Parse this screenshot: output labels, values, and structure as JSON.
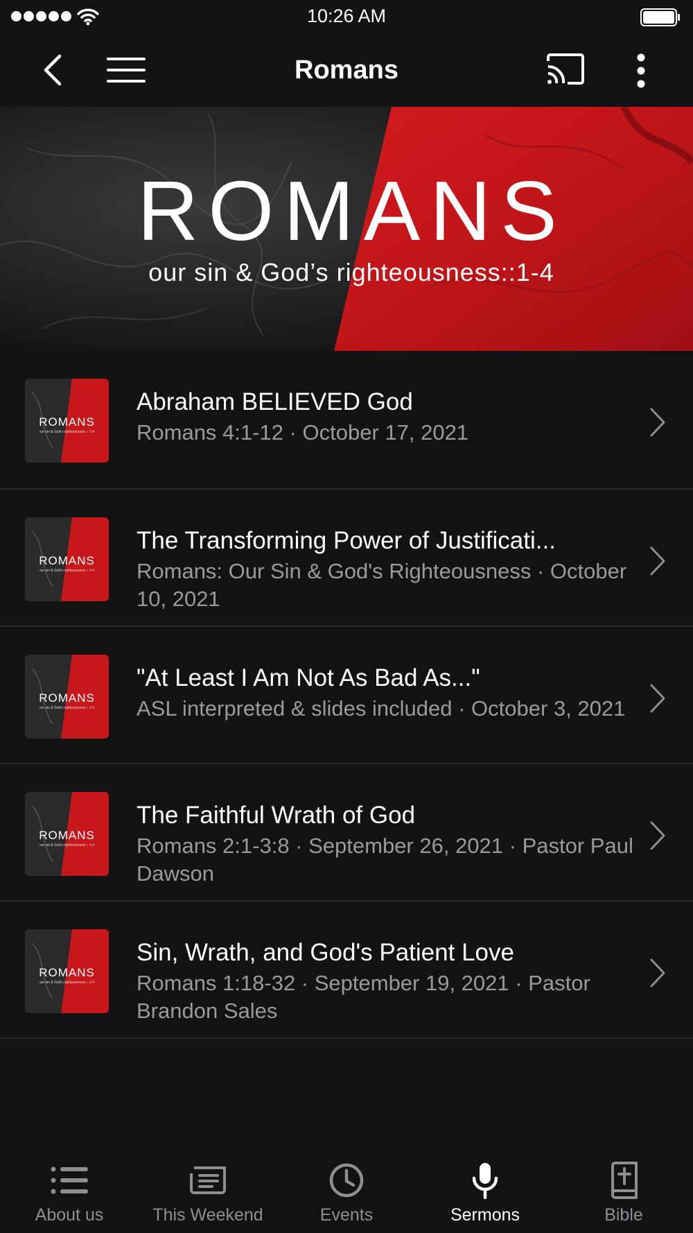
{
  "status_bar": {
    "time": "10:26 AM"
  },
  "nav": {
    "title": "Romans",
    "back_icon": "chevron-left-icon",
    "menu_icon": "hamburger-menu-icon",
    "cast_icon": "cast-icon",
    "more_icon": "more-vertical-icon"
  },
  "banner": {
    "title": "ROMANS",
    "subtitle": "our sin & God’s righteousness::1-4",
    "colors": {
      "dark": "#1e1e1e",
      "red": "#c8171b"
    }
  },
  "sermons": [
    {
      "title": "Abraham BELIEVED God",
      "subtitle": "Romans 4:1-12 · October 17, 2021",
      "thumbnail_title": "ROMANS",
      "thumbnail_subtitle": "our sin & God's righteousness :: 1-4"
    },
    {
      "title": "The Transforming Power of Justificati...",
      "subtitle": "Romans: Our Sin & God's Righteousness · October 10, 2021",
      "thumbnail_title": "ROMANS",
      "thumbnail_subtitle": "our sin & God's righteousness :: 1-4"
    },
    {
      "title": "\"At Least I Am Not As Bad As...\"",
      "subtitle": "ASL interpreted & slides included · October 3, 2021",
      "thumbnail_title": "ROMANS",
      "thumbnail_subtitle": "our sin & God's righteousness :: 1-4"
    },
    {
      "title": "The Faithful Wrath of God",
      "subtitle": "Romans 2:1-3:8 · September 26, 2021 · Pastor Paul Dawson",
      "thumbnail_title": "ROMANS",
      "thumbnail_subtitle": "our sin & God's righteousness :: 1-4"
    },
    {
      "title": "Sin, Wrath, and God's Patient Love",
      "subtitle": "Romans 1:18-32 · September 19, 2021 · Pastor Brandon Sales",
      "thumbnail_title": "ROMANS",
      "thumbnail_subtitle": "our sin & God's righteousness :: 1-4"
    }
  ],
  "tabs": [
    {
      "label": "About us",
      "icon": "list-icon",
      "active": false
    },
    {
      "label": "This Weekend",
      "icon": "bulletin-icon",
      "active": false
    },
    {
      "label": "Events",
      "icon": "clock-icon",
      "active": false
    },
    {
      "label": "Sermons",
      "icon": "microphone-icon",
      "active": true
    },
    {
      "label": "Bible",
      "icon": "bible-icon",
      "active": false
    }
  ],
  "colors": {
    "background": "#131316",
    "separator": "#2a2b2f",
    "secondary_text": "#9a9a9f",
    "tab_inactive": "#8e8e93",
    "tab_active": "#ffffff"
  }
}
